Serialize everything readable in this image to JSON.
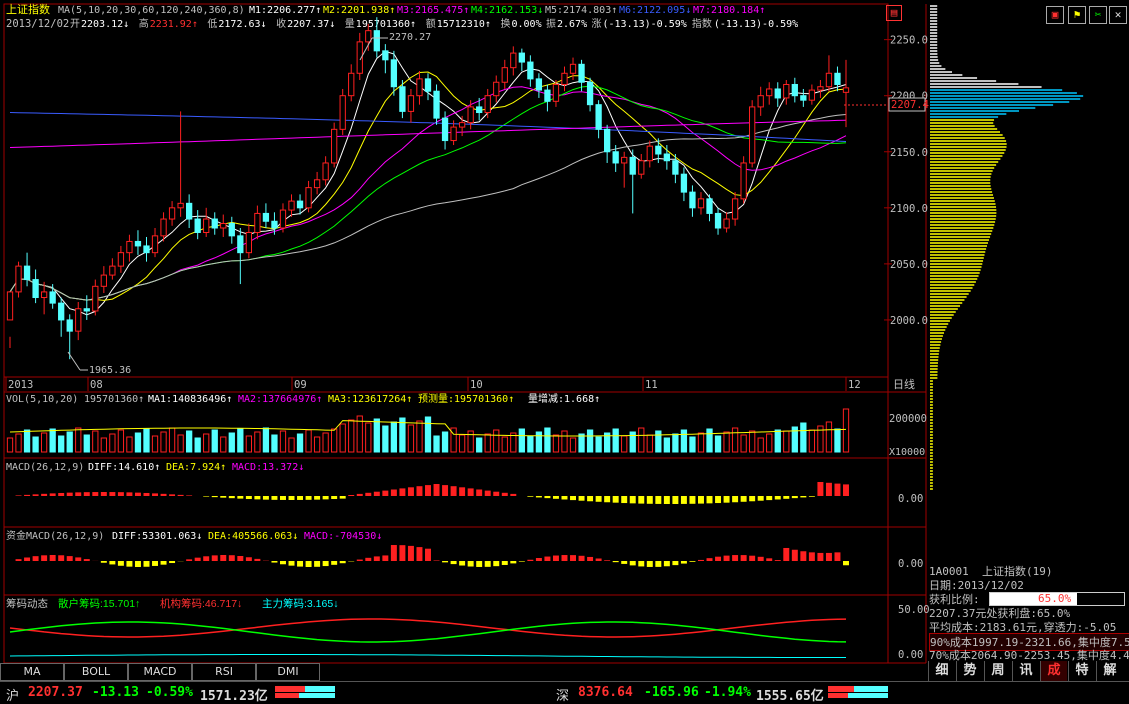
{
  "header": {
    "index_name": "上证指数",
    "ma_prefix": "MA(5,10,20,30,60,120,240,360,8)",
    "ma_items": [
      {
        "label": "M1:2206.277↑",
        "color": "#ffffff"
      },
      {
        "label": "M2:2201.938↑",
        "color": "#ffff00"
      },
      {
        "label": "M3:2165.475↑",
        "color": "#ff00ff"
      },
      {
        "label": "M4:2162.153↓",
        "color": "#00ff00"
      },
      {
        "label": "M5:2174.803↑",
        "color": "#c0c0c0"
      },
      {
        "label": "M6:2122.095↓",
        "color": "#3a5cff"
      },
      {
        "label": "M7:2180.184↑",
        "color": "#ff00ff"
      }
    ],
    "date": "2013/12/02",
    "open_label": "开",
    "open": "2203.12↓",
    "high_label": "高",
    "high": "2231.92↑",
    "low_label": "低",
    "low": "2172.63↓",
    "close_label": "收",
    "close": "2207.37↓",
    "vol_label": "量",
    "vol": "195701360↑",
    "amt_label": "额",
    "amt": "15712310↑",
    "turn_label": "换",
    "turn": "0.00%",
    "amp_label": "振",
    "amp": "2.67%",
    "chg_label": "涨",
    "chg": "(-13.13)-0.59%",
    "idx_label": "指数",
    "idx": "(-13.13)-0.59%"
  },
  "price_panel": {
    "y_ticks": [
      "2250.0",
      "2200.0",
      "2150.0",
      "2100.0",
      "2050.0",
      "2000.0"
    ],
    "current_price_label": "2207.4",
    "high_annotation": "2270.27",
    "low_annotation": "1965.36",
    "x_labels": [
      "2013",
      "08",
      "09",
      "10",
      "11",
      "12"
    ],
    "period": "日线"
  },
  "vol_panel": {
    "title": "VOL(5,10,20)",
    "value": "195701360↑",
    "ma1": "MA1:140836496↑",
    "ma2": "MA2:137664976↑",
    "ma3": "MA3:123617264↑",
    "forecast": "预测量:195701360↑",
    "change": "量增减:1.668↑",
    "y_tick": "200000",
    "unit": "X10000"
  },
  "macd_panel": {
    "title": "MACD(26,12,9)",
    "diff": "DIFF:14.610↑",
    "dea": "DEA:7.924↑",
    "macd": "MACD:13.372↓",
    "y_tick": "0.00"
  },
  "fund_macd_panel": {
    "title": "资金MACD(26,12,9)",
    "diff": "DIFF:53301.063↓",
    "dea": "DEA:405566.063↓",
    "macd": "MACD:-704530↓",
    "y_tick": "0.00"
  },
  "chip_panel": {
    "title": "筹码动态",
    "retail": "散户筹码:15.701↑",
    "inst": "机构筹码:46.717↓",
    "main": "主力筹码:3.165↓",
    "y_ticks": [
      "50.00",
      "0.00"
    ]
  },
  "indicator_tabs": [
    "MA",
    "BOLL",
    "MACD",
    "RSI",
    "DMI"
  ],
  "right_info": {
    "code_line": "1A0001  上证指数(19)",
    "date_line": "日期:2013/12/02",
    "profit_label": "获利比例:",
    "profit_value": "65.0%",
    "profit_pct": 0.65,
    "line1": "2207.37元处获利盘:65.0%",
    "line2": "平均成本:2183.61元,穿透力:-5.05",
    "line3": "90%成本1997.19-2321.66,集中度7.5",
    "line4": "70%成本2064.90-2253.45,集中度4.4"
  },
  "right_tabs": [
    "细",
    "势",
    "周",
    "讯",
    "成",
    "特",
    "解"
  ],
  "status_bar": {
    "sh_label": "沪",
    "sh_price": "2207.37",
    "sh_change": "-13.13",
    "sh_pct": "-0.59%",
    "sh_amount": "1571.23亿",
    "sz_label": "深",
    "sz_price": "8376.64",
    "sz_change": "-165.96",
    "sz_pct": "-1.94%",
    "sz_amount": "1555.65亿"
  },
  "colors": {
    "up": "#ff2020",
    "down": "#54ffff",
    "axis": "#b00000",
    "text": "#c0c0c0"
  },
  "chart_data": {
    "type": "candlestick",
    "ylim": [
      1950,
      2280
    ],
    "candles": [
      [
        2000,
        2025,
        1985,
        1975
      ],
      [
        2025,
        2048,
        2020,
        2052
      ],
      [
        2048,
        2036,
        2030,
        2060
      ],
      [
        2036,
        2020,
        2015,
        2045
      ],
      [
        2020,
        2025,
        2005,
        2034
      ],
      [
        2025,
        2015,
        2010,
        2032
      ],
      [
        2015,
        2000,
        1985,
        2020
      ],
      [
        2000,
        1990,
        1965,
        2005
      ],
      [
        1990,
        2010,
        1982,
        2016
      ],
      [
        2010,
        2008,
        2000,
        2022
      ],
      [
        2008,
        2030,
        2004,
        2036
      ],
      [
        2030,
        2040,
        2024,
        2048
      ],
      [
        2040,
        2048,
        2036,
        2055
      ],
      [
        2048,
        2060,
        2042,
        2066
      ],
      [
        2060,
        2070,
        2052,
        2076
      ],
      [
        2070,
        2066,
        2058,
        2080
      ],
      [
        2066,
        2060,
        2052,
        2074
      ],
      [
        2060,
        2075,
        2056,
        2082
      ],
      [
        2075,
        2090,
        2070,
        2096
      ],
      [
        2090,
        2100,
        2084,
        2106
      ],
      [
        2100,
        2104,
        2092,
        2186
      ],
      [
        2104,
        2090,
        2082,
        2112
      ],
      [
        2090,
        2078,
        2072,
        2098
      ],
      [
        2078,
        2090,
        2074,
        2100
      ],
      [
        2090,
        2082,
        2076,
        2096
      ],
      [
        2082,
        2086,
        2074,
        2094
      ],
      [
        2086,
        2075,
        2068,
        2092
      ],
      [
        2075,
        2060,
        2032,
        2082
      ],
      [
        2060,
        2078,
        2055,
        2086
      ],
      [
        2078,
        2095,
        2072,
        2102
      ],
      [
        2095,
        2088,
        2082,
        2104
      ],
      [
        2088,
        2082,
        2076,
        2096
      ],
      [
        2082,
        2098,
        2078,
        2104
      ],
      [
        2098,
        2106,
        2092,
        2112
      ],
      [
        2106,
        2100,
        2094,
        2112
      ],
      [
        2100,
        2118,
        2096,
        2124
      ],
      [
        2118,
        2125,
        2112,
        2132
      ],
      [
        2125,
        2140,
        2120,
        2146
      ],
      [
        2140,
        2170,
        2136,
        2176
      ],
      [
        2170,
        2200,
        2165,
        2206
      ],
      [
        2200,
        2220,
        2195,
        2228
      ],
      [
        2220,
        2248,
        2214,
        2256
      ],
      [
        2248,
        2258,
        2240,
        2264
      ],
      [
        2258,
        2240,
        2234,
        2270
      ],
      [
        2240,
        2232,
        2220,
        2246
      ],
      [
        2232,
        2208,
        2200,
        2240
      ],
      [
        2208,
        2186,
        2180,
        2214
      ],
      [
        2186,
        2200,
        2176,
        2206
      ],
      [
        2200,
        2215,
        2192,
        2222
      ],
      [
        2215,
        2204,
        2196,
        2220
      ],
      [
        2204,
        2180,
        2174,
        2210
      ],
      [
        2180,
        2160,
        2152,
        2186
      ],
      [
        2160,
        2172,
        2156,
        2178
      ],
      [
        2172,
        2176,
        2164,
        2182
      ],
      [
        2176,
        2190,
        2170,
        2196
      ],
      [
        2190,
        2185,
        2178,
        2198
      ],
      [
        2185,
        2200,
        2180,
        2206
      ],
      [
        2200,
        2212,
        2194,
        2218
      ],
      [
        2212,
        2225,
        2206,
        2232
      ],
      [
        2225,
        2238,
        2218,
        2244
      ],
      [
        2238,
        2230,
        2222,
        2242
      ],
      [
        2230,
        2215,
        2208,
        2236
      ],
      [
        2215,
        2205,
        2198,
        2220
      ],
      [
        2205,
        2195,
        2186,
        2210
      ],
      [
        2195,
        2210,
        2190,
        2214
      ],
      [
        2210,
        2220,
        2204,
        2226
      ],
      [
        2220,
        2228,
        2214,
        2234
      ],
      [
        2228,
        2212,
        2204,
        2232
      ],
      [
        2212,
        2192,
        2186,
        2216
      ],
      [
        2192,
        2170,
        2162,
        2196
      ],
      [
        2170,
        2150,
        2140,
        2174
      ],
      [
        2150,
        2140,
        2132,
        2156
      ],
      [
        2140,
        2145,
        2118,
        2150
      ],
      [
        2145,
        2130,
        2095,
        2152
      ],
      [
        2130,
        2142,
        2126,
        2148
      ],
      [
        2142,
        2155,
        2136,
        2160
      ],
      [
        2155,
        2148,
        2140,
        2162
      ],
      [
        2148,
        2142,
        2134,
        2156
      ],
      [
        2142,
        2130,
        2122,
        2148
      ],
      [
        2130,
        2114,
        2106,
        2136
      ],
      [
        2114,
        2100,
        2092,
        2120
      ],
      [
        2100,
        2108,
        2094,
        2114
      ],
      [
        2108,
        2095,
        2088,
        2112
      ],
      [
        2095,
        2082,
        2076,
        2100
      ],
      [
        2082,
        2090,
        2078,
        2096
      ],
      [
        2090,
        2108,
        2084,
        2114
      ],
      [
        2108,
        2140,
        2104,
        2146
      ],
      [
        2140,
        2190,
        2136,
        2196
      ],
      [
        2190,
        2200,
        2182,
        2208
      ],
      [
        2200,
        2206,
        2192,
        2212
      ],
      [
        2206,
        2198,
        2190,
        2212
      ],
      [
        2198,
        2210,
        2192,
        2214
      ],
      [
        2210,
        2200,
        2194,
        2216
      ],
      [
        2200,
        2196,
        2190,
        2206
      ],
      [
        2196,
        2205,
        2192,
        2210
      ],
      [
        2205,
        2208,
        2198,
        2214
      ],
      [
        2208,
        2220,
        2204,
        2236
      ],
      [
        2220,
        2210,
        2204,
        2226
      ],
      [
        2203,
        2207,
        2172,
        2232
      ]
    ]
  }
}
